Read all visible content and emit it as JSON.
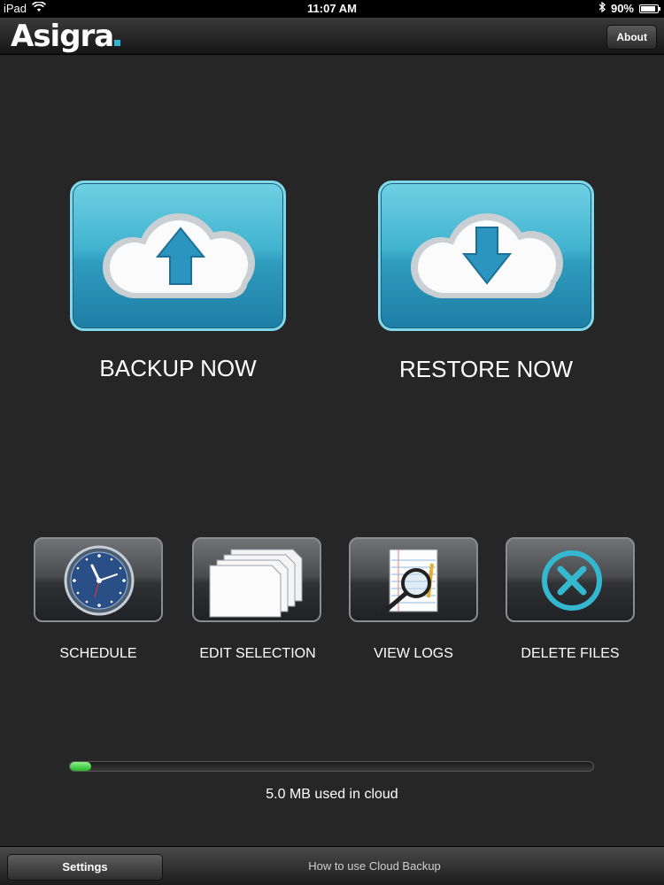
{
  "status_bar": {
    "device": "iPad",
    "time": "11:07 AM",
    "battery": "90%",
    "battery_level": 0.9
  },
  "header": {
    "logo": "Asigra",
    "about_label": "About"
  },
  "main_actions": [
    {
      "label": "BACKUP NOW",
      "icon": "cloud-upload-icon"
    },
    {
      "label": "RESTORE NOW",
      "icon": "cloud-download-icon"
    }
  ],
  "tools": [
    {
      "label": "SCHEDULE",
      "icon": "clock-icon"
    },
    {
      "label": "EDIT SELECTION",
      "icon": "documents-icon"
    },
    {
      "label": "VIEW LOGS",
      "icon": "magnifier-notepad-icon"
    },
    {
      "label": "DELETE FILES",
      "icon": "delete-circle-icon"
    }
  ],
  "storage": {
    "usage_text": "5.0 MB used in cloud",
    "usage_fraction": 0.04
  },
  "toolbar": {
    "settings_label": "Settings",
    "howto_label": "How to use Cloud Backup"
  },
  "colors": {
    "accent": "#41b3cf",
    "progress": "#28b828",
    "background": "#262626"
  }
}
